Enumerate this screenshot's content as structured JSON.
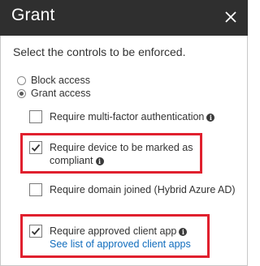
{
  "panel": {
    "title": "Grant",
    "intro": "Select the controls to be enforced."
  },
  "radios": [
    {
      "label": "Block access",
      "checked": false
    },
    {
      "label": "Grant access",
      "checked": true
    }
  ],
  "controls": {
    "mfa": {
      "label": "Require multi-factor authentication",
      "checked": false
    },
    "compliant": {
      "line1": "Require device to be marked as",
      "line2": "compliant",
      "checked": true
    },
    "domain_joined": {
      "label": "Require domain joined (Hybrid Azure AD)",
      "checked": false
    },
    "approved_app": {
      "label": "Require approved client app",
      "checked": true,
      "link": "See list of approved client apps"
    }
  },
  "info_glyph": "i",
  "colors": {
    "header": "#2f2f2f",
    "highlight": "#e0202e",
    "link": "#0f6cbd"
  }
}
